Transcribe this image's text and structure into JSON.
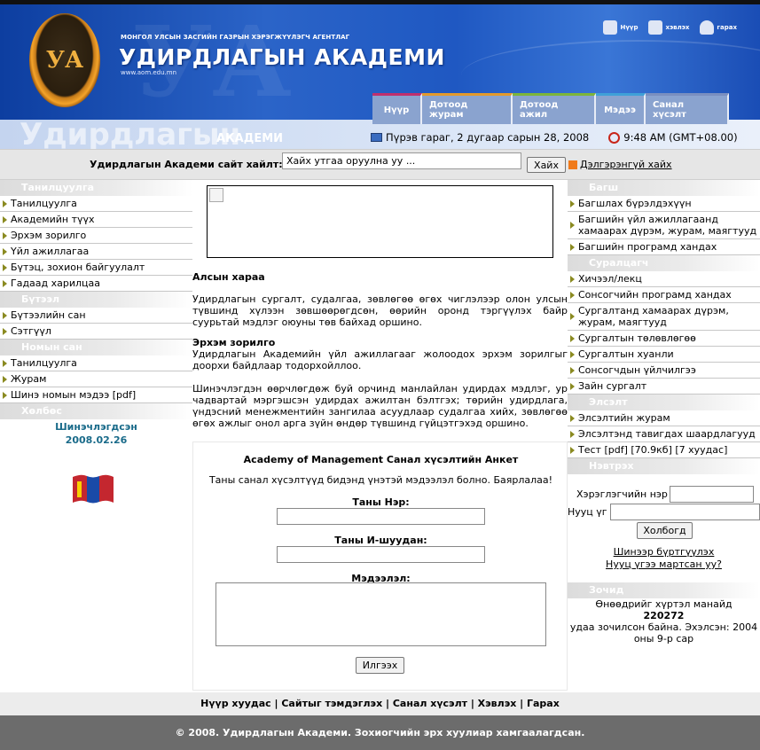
{
  "header": {
    "agency": "МОНГОЛ УЛСЫН ЗАСГИЙН ГАЗРЫН ХЭРЭГЖҮҮЛЭГЧ АГЕНТЛАГ",
    "title": "УДИРДЛАГЫН АКАДЕМИ",
    "url": "www.aom.edu.mn",
    "logo_text": "УА",
    "banner_word": "Удирдлагын",
    "banner_word2": "АКАДЕМИ",
    "toplinks": {
      "home": "Нүүр",
      "print": "хэвлэх",
      "exit": "гарах"
    }
  },
  "nav": {
    "tabs": [
      {
        "label": "Нүүр",
        "color": "#c0306e"
      },
      {
        "label": "Дотоод журам",
        "color": "#e39a2c"
      },
      {
        "label": "Дотоод ажил",
        "color": "#7db53a"
      },
      {
        "label": "Мэдээ",
        "color": "#3fa0d8"
      },
      {
        "label": "Санал хүсэлт",
        "color": "#7a8fc0"
      }
    ]
  },
  "dateline": {
    "date": "Пүрэв гараг, 2 дугаар сарын 28, 2008",
    "time": "9:48 AM (GMT+08.00)"
  },
  "search": {
    "label": "Удирдлагын Академи сайт хайлт:",
    "value": "Хайх утгаа оруулна уу ...",
    "button": "Хайх",
    "advanced": "Дэлгэрэнгүй хайх"
  },
  "left": {
    "sections": [
      {
        "title": "Танилцуулга",
        "items": [
          "Танилцуулга",
          "Академийн түүх",
          "Эрхэм зорилго",
          "Үйл ажиллагаа",
          "Бүтэц, зохион байгуулалт",
          "Гадаад харилцаа"
        ]
      },
      {
        "title": "Бүтээл",
        "items": [
          "Бүтээлийн сан",
          "Сэтгүүл"
        ]
      },
      {
        "title": "Номын сан",
        "items": [
          "Танилцуулга",
          "Журам",
          "Шинэ номын мэдээ [pdf]"
        ]
      },
      {
        "title": "Хөлбөс",
        "items": []
      }
    ],
    "updated_label": "Шинэчлэгдсэн",
    "updated_date": "2008.02.26"
  },
  "main": {
    "vision_title": "Алсын хараа",
    "vision_text": "Удирдлагын сургалт, судалгаа, зөвлөгөө өгөх чиглэлээр олон улсын түвшинд хүлээн зөвшөөрөгдсөн, өөрийн оронд тэргүүлэх байр суурьтай мэдлэг оюуны төв байхад оршино.",
    "mission_title": "Эрхэм зорилго",
    "mission_text": "Удирдлагын Академийн үйл ажиллагааг жолоодох эрхэм зорилгыг доорхи байдлаар тодорхойллоо.",
    "mission_text2": "Шинэчлэгдэн өөрчлөгдөж буй орчинд манлайлан удирдах мэдлэг, ур чадвартай мэргэшсэн удирдах ажилтан бэлтгэх; төрийн удирдлага, үндэсний менежментийн зангилаа асуудлаар судалгаа хийх, зөвлөгөө өгөх ажлыг онол арга зүйн өндөр түвшинд гүйцэтгэхэд оршино."
  },
  "form": {
    "title": "Academy of Management Санал хүсэлтийн Анкет",
    "subtitle": "Таны санал хүсэлтүүд бидэнд үнэтэй мэдээлэл болно. Баярлалаа!",
    "name_label": "Таны Нэр:",
    "email_label": "Таны И-шуудан:",
    "message_label": "Мэдээлэл:",
    "submit": "Илгээх"
  },
  "right": {
    "sections": [
      {
        "title": "Багш",
        "items": [
          "Багшлах бүрэлдэхүүн",
          "Багшийн үйл ажиллагаанд хамаарах дүрэм, журам, маягтууд",
          "Багшийн програмд хандах"
        ]
      },
      {
        "title": "Суралцагч",
        "items": [
          "Хичээл/лекц",
          "Сонсогчийн програмд хандах",
          "Сургалтанд хамаарах дүрэм, журам, маягтууд",
          "Сургалтын төлөвлөгөө",
          "Сургалтын хуанли",
          "Сонсогчдын үйлчилгээ",
          "Зайн сургалт"
        ]
      },
      {
        "title": "Элсэлт",
        "items": [
          "Элсэлтийн журам",
          "Элсэлтэнд тавигдах шаардлагууд",
          "Тест [pdf] [70.9кб] [7 хуудас]"
        ]
      },
      {
        "title": "Нэвтрэх",
        "items": []
      }
    ]
  },
  "login": {
    "username_label": "Хэрэглэгчийн нэр",
    "password_label": "Нууц үг",
    "button": "Холбогд",
    "register": "Шинээр бүртгүүлэх",
    "forgot": "Нууц үгээ мартсан уу?"
  },
  "visitor": {
    "title": "Зочид",
    "line1": "Өнөөдрийг хүртэл манайд",
    "count": "220272",
    "line2": "удаа зочилсон байна. Эхэлсэн: 2004 оны 9-р сар"
  },
  "footer": {
    "links": "Нүүр хуудас | Сайтыг тэмдэглэх | Санал хүсэлт | Хэвлэх | Гарах",
    "copyright": "© 2008. Удирдлагын Академи. Зохиогчийн эрх хуулиар хамгаалагдсан."
  }
}
